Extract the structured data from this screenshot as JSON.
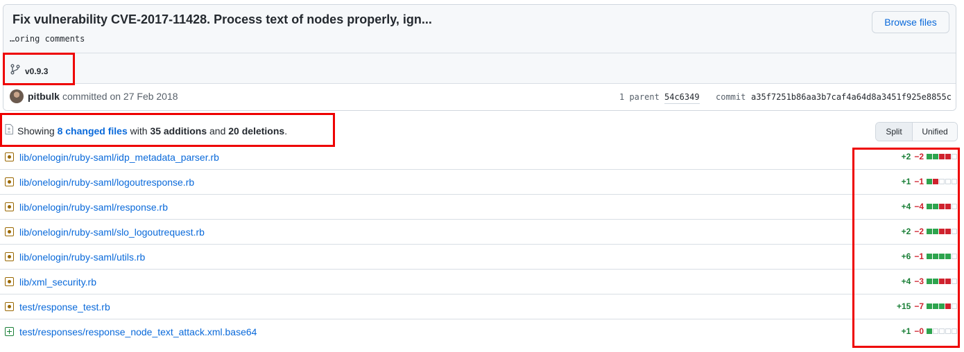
{
  "commit": {
    "title": "Fix vulnerability CVE-2017-11428. Process text of nodes properly, ign...",
    "description": "…oring comments",
    "browse_files_label": "Browse files",
    "branch": "v0.9.3",
    "author": "pitbulk",
    "action": "committed on 27 Feb 2018",
    "parent_label": "1 parent",
    "parent_sha": "54c6349",
    "commit_label": "commit",
    "commit_sha": "a35f7251b86aa3b7caf4a64d8a3451f925e8855c"
  },
  "summary": {
    "prefix": "Showing",
    "changed_files": "8 changed files",
    "with": "with",
    "additions": "35 additions",
    "and": "and",
    "deletions": "20 deletions",
    "suffix": "."
  },
  "view_toggle": {
    "split": "Split",
    "unified": "Unified",
    "selected": "Split"
  },
  "files": [
    {
      "path": "lib/onelogin/ruby-saml/idp_metadata_parser.rb",
      "status": "modified",
      "additions": "+2",
      "deletions": "−2",
      "blocks": [
        "g",
        "g",
        "r",
        "r",
        "n"
      ]
    },
    {
      "path": "lib/onelogin/ruby-saml/logoutresponse.rb",
      "status": "modified",
      "additions": "+1",
      "deletions": "−1",
      "blocks": [
        "g",
        "r",
        "n",
        "n",
        "n"
      ]
    },
    {
      "path": "lib/onelogin/ruby-saml/response.rb",
      "status": "modified",
      "additions": "+4",
      "deletions": "−4",
      "blocks": [
        "g",
        "g",
        "r",
        "r",
        "n"
      ]
    },
    {
      "path": "lib/onelogin/ruby-saml/slo_logoutrequest.rb",
      "status": "modified",
      "additions": "+2",
      "deletions": "−2",
      "blocks": [
        "g",
        "g",
        "r",
        "r",
        "n"
      ]
    },
    {
      "path": "lib/onelogin/ruby-saml/utils.rb",
      "status": "modified",
      "additions": "+6",
      "deletions": "−1",
      "blocks": [
        "g",
        "g",
        "g",
        "g",
        "n"
      ]
    },
    {
      "path": "lib/xml_security.rb",
      "status": "modified",
      "additions": "+4",
      "deletions": "−3",
      "blocks": [
        "g",
        "g",
        "r",
        "r",
        "n"
      ]
    },
    {
      "path": "test/response_test.rb",
      "status": "modified",
      "additions": "+15",
      "deletions": "−7",
      "blocks": [
        "g",
        "g",
        "g",
        "r",
        "n"
      ]
    },
    {
      "path": "test/responses/response_node_text_attack.xml.base64",
      "status": "added",
      "additions": "+1",
      "deletions": "−0",
      "blocks": [
        "g",
        "n",
        "n",
        "n",
        "n"
      ]
    }
  ],
  "colors": {
    "link": "#0969da",
    "addition": "#1a7f37",
    "deletion": "#cf222e",
    "modified_icon": "#9a6700",
    "highlight": "#ee0000"
  }
}
